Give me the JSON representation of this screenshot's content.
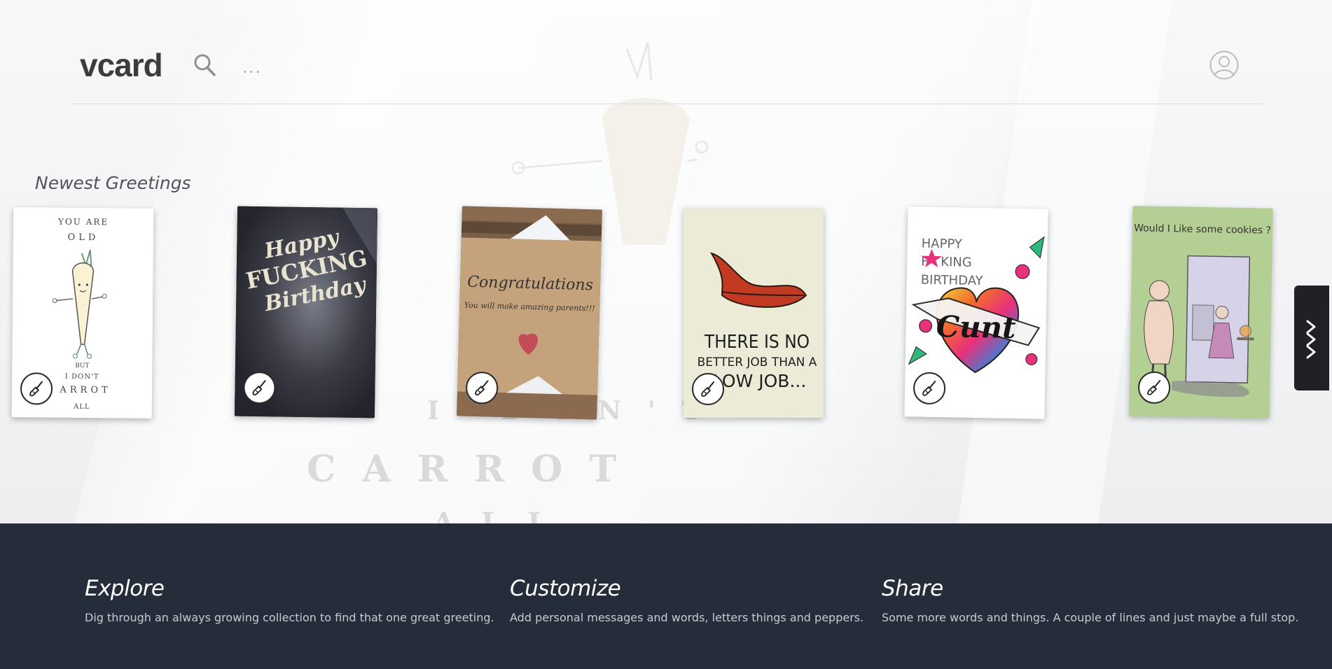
{
  "header": {
    "logo": "vcard",
    "more_label": "...",
    "icons": {
      "search": "search-icon",
      "user": "user-circle-icon"
    }
  },
  "background_art": {
    "lines": [
      "I DON'T",
      "CARROT",
      "ALL"
    ]
  },
  "gallery": {
    "title": "Newest Greetings",
    "cards": [
      {
        "name": "carrot-card",
        "lines": [
          "YOU ARE",
          "OLD",
          "BUT",
          "I DON'T",
          "ARROT",
          "ALL"
        ]
      },
      {
        "name": "happy-birthday-dark-card",
        "lines": [
          "Happy",
          "FUCKING",
          "Birthday"
        ]
      },
      {
        "name": "congratulations-kraft-card",
        "lines": [
          "Congratulations",
          "You will make amazing parents!!!"
        ]
      },
      {
        "name": "lips-card",
        "lines": [
          "THERE IS NO",
          "BETTER JOB THAN A",
          "BLOW JOB..."
        ]
      },
      {
        "name": "tattoo-heart-card",
        "lines": [
          "HAPPY",
          "F",
          "KING",
          "BIRTHDAY",
          "Cunt"
        ]
      },
      {
        "name": "cookies-cartoon-card",
        "lines": [
          "Would I Like some cookies ?"
        ]
      }
    ],
    "customize_icon": "paintbrush-icon",
    "next_icon": "triple-chevron-right-icon"
  },
  "footer": {
    "features": [
      {
        "title": "Explore",
        "text": "Dig through an always growing collection to find that one great greeting."
      },
      {
        "title": "Customize",
        "text": "Add personal messages and words, letters things and peppers."
      },
      {
        "title": "Share",
        "text": "Some more words and things. A couple of lines and just maybe a full stop."
      }
    ]
  },
  "colors": {
    "footer_bg": "#262d3a",
    "next_button_bg": "#1f2124",
    "logo": "#3c3c3c"
  }
}
